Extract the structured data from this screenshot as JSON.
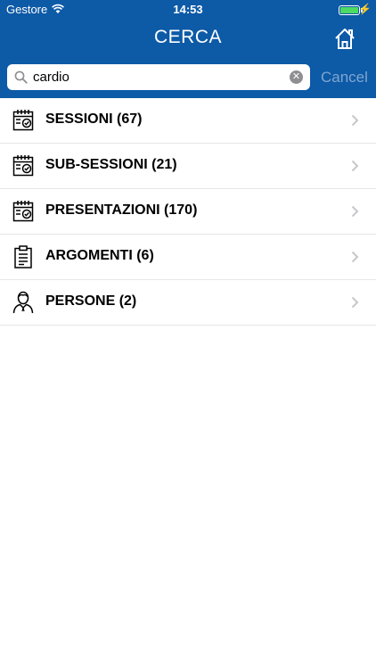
{
  "status_bar": {
    "carrier": "Gestore",
    "time": "14:53",
    "battery_color": "#4cd964"
  },
  "nav": {
    "title": "CERCA",
    "home_icon": "home-icon",
    "background": "#0d5aa7"
  },
  "search": {
    "value": "cardio",
    "placeholder": "",
    "cancel_label": "Cancel"
  },
  "results": [
    {
      "label": "SESSIONI (67)",
      "icon": "calendar-check-icon"
    },
    {
      "label": "SUB-SESSIONI (21)",
      "icon": "calendar-check-icon"
    },
    {
      "label": "PRESENTAZIONI (170)",
      "icon": "calendar-check-icon"
    },
    {
      "label": "ARGOMENTI (6)",
      "icon": "clipboard-icon"
    },
    {
      "label": "PERSONE (2)",
      "icon": "person-icon"
    }
  ]
}
